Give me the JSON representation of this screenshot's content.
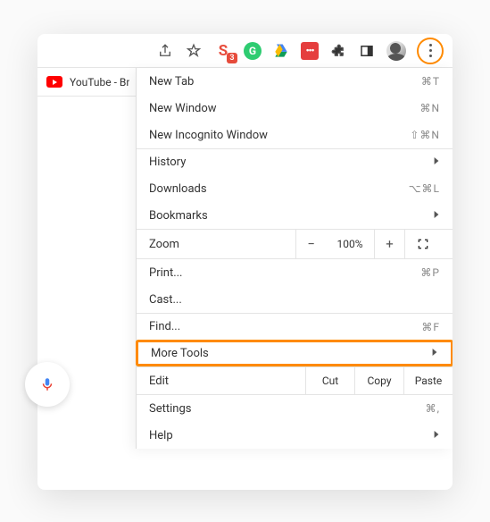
{
  "tab": {
    "title": "YouTube - Br"
  },
  "toolbar_icons": {
    "s_badge_letter": "S",
    "s_badge_count": "3",
    "g_letter": "G",
    "lp_text": "•••"
  },
  "menu": {
    "new_tab": {
      "label": "New Tab",
      "shortcut": "⌘T"
    },
    "new_window": {
      "label": "New Window",
      "shortcut": "⌘N"
    },
    "new_incognito": {
      "label": "New Incognito Window",
      "shortcut": "⇧⌘N"
    },
    "history": {
      "label": "History"
    },
    "downloads": {
      "label": "Downloads",
      "shortcut": "⌥⌘L"
    },
    "bookmarks": {
      "label": "Bookmarks"
    },
    "zoom": {
      "label": "Zoom",
      "value": "100%",
      "minus": "−",
      "plus": "+"
    },
    "print": {
      "label": "Print...",
      "shortcut": "⌘P"
    },
    "cast": {
      "label": "Cast..."
    },
    "find": {
      "label": "Find...",
      "shortcut": "⌘F"
    },
    "more_tools": {
      "label": "More Tools"
    },
    "edit": {
      "label": "Edit",
      "cut": "Cut",
      "copy": "Copy",
      "paste": "Paste"
    },
    "settings": {
      "label": "Settings",
      "shortcut": "⌘,"
    },
    "help": {
      "label": "Help"
    }
  }
}
